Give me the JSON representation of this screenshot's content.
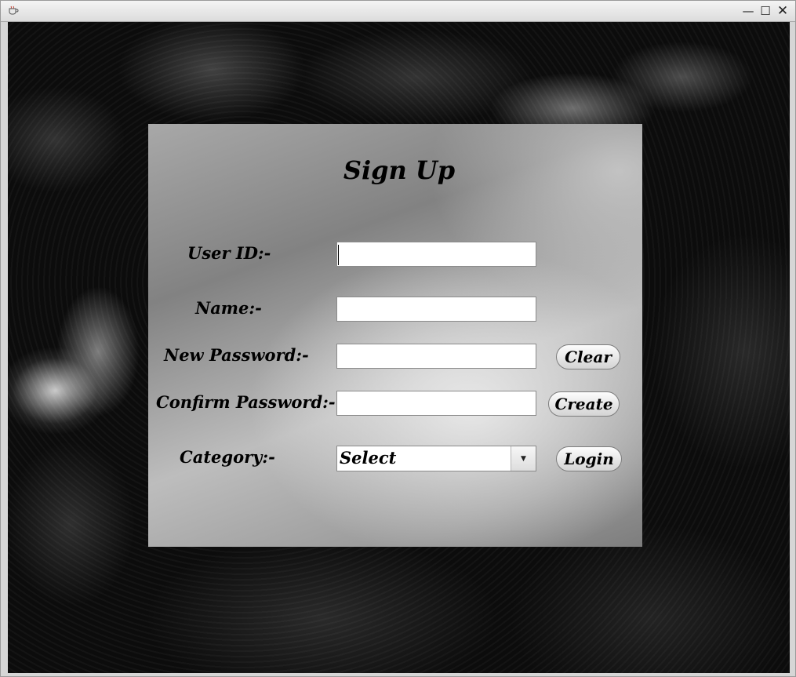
{
  "window": {
    "minimize_glyph": "—",
    "maximize_glyph": "☐",
    "close_glyph": "✕"
  },
  "form": {
    "title": "Sign Up",
    "fields": {
      "user_id": {
        "label": "User ID:-",
        "value": ""
      },
      "name": {
        "label": "Name:-",
        "value": ""
      },
      "new_password": {
        "label": "New Password:-",
        "value": ""
      },
      "confirm_password": {
        "label": "Confirm Password:-",
        "value": ""
      },
      "category": {
        "label": "Category:-",
        "selected": "Select"
      }
    },
    "buttons": {
      "clear": "Clear",
      "create": "Create",
      "login": "Login"
    }
  },
  "icons": {
    "app": "coffee-cup-icon",
    "minimize": "minimize-icon",
    "maximize": "maximize-icon",
    "close": "close-icon",
    "dropdown": "chevron-down-icon"
  }
}
